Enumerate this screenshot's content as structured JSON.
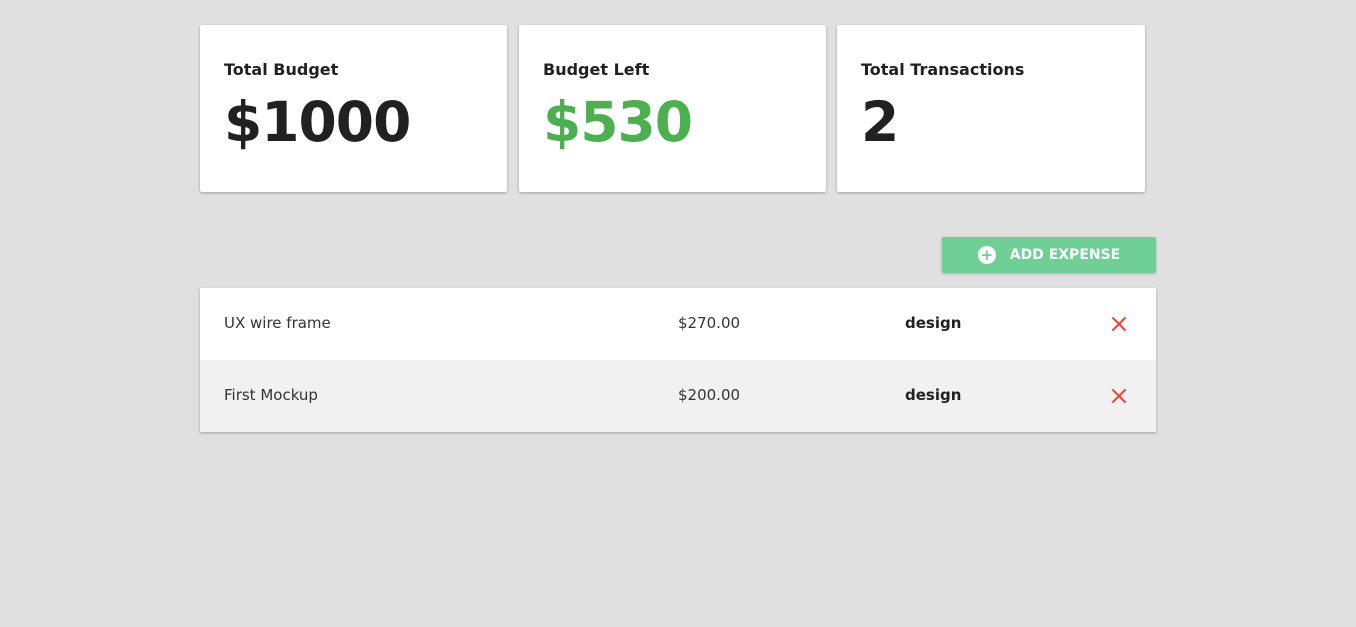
{
  "summary": {
    "total_budget": {
      "label": "Total Budget",
      "value": "$1000"
    },
    "budget_left": {
      "label": "Budget Left",
      "value": "$530"
    },
    "total_transactions": {
      "label": "Total Transactions",
      "value": "2"
    }
  },
  "actions": {
    "add_expense_label": "ADD EXPENSE",
    "add_icon": "plus-circle-icon"
  },
  "expenses": [
    {
      "name": "UX wire frame",
      "amount": "$270.00",
      "category": "design",
      "delete_icon": "close-icon"
    },
    {
      "name": "First Mockup",
      "amount": "$200.00",
      "category": "design",
      "delete_icon": "close-icon"
    }
  ],
  "colors": {
    "background": "#e0e0e0",
    "positive": "#4caf50",
    "button": "#6fcf97",
    "delete": "#f44336"
  }
}
